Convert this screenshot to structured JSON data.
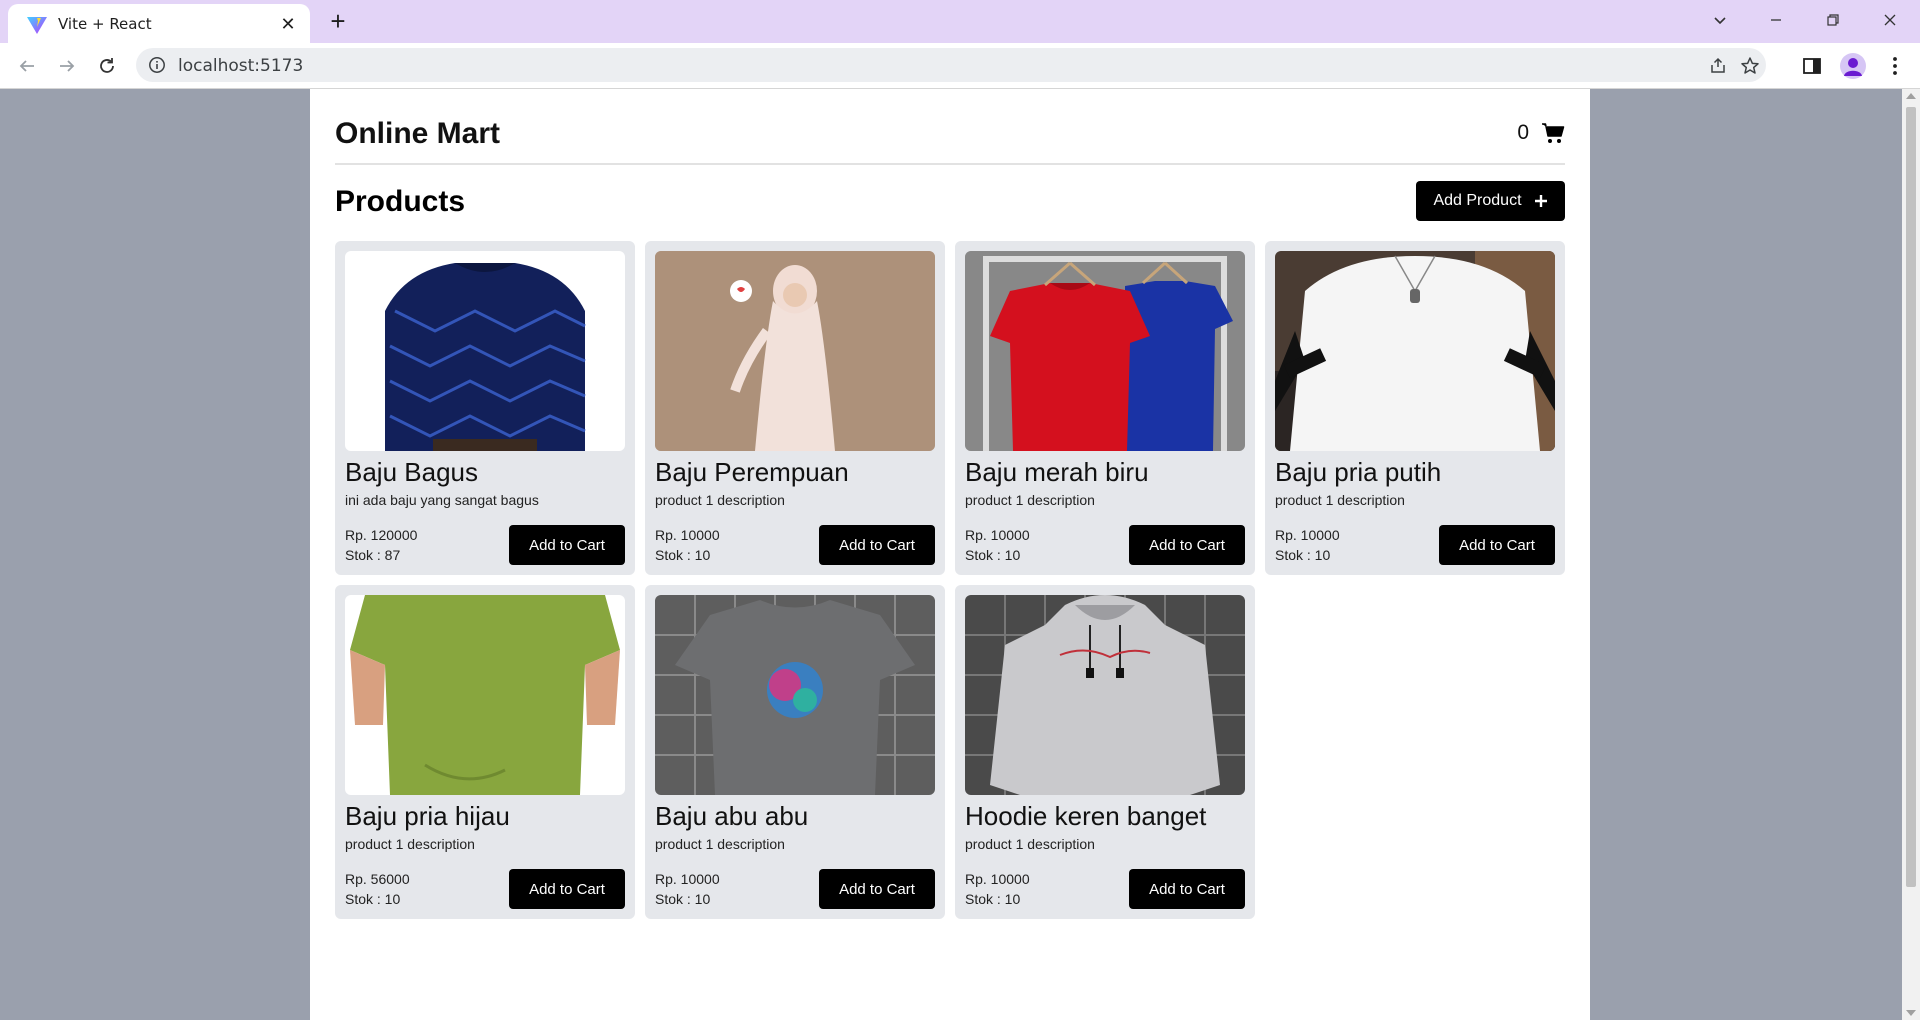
{
  "browser": {
    "tab_title": "Vite + React",
    "tab_close": "✕",
    "new_tab": "+",
    "url": "localhost:5173",
    "accent": "#e3d4f7"
  },
  "app": {
    "brand": "Online Mart",
    "cart_count": "0",
    "section_title": "Products",
    "add_product_label": "Add Product"
  },
  "products": [
    {
      "name": "Baju Bagus",
      "description": "ini ada baju yang sangat bagus",
      "price": "Rp. 120000",
      "stock": "Stok : 87",
      "button": "Add to Cart",
      "image": "navy-long-sleeve-shirt"
    },
    {
      "name": "Baju Perempuan",
      "description": "product 1 description",
      "price": "Rp. 10000",
      "stock": "Stok : 10",
      "button": "Add to Cart",
      "image": "woman-in-hijab-dress"
    },
    {
      "name": "Baju merah biru",
      "description": "product 1 description",
      "price": "Rp. 10000",
      "stock": "Stok : 10",
      "button": "Add to Cart",
      "image": "red-and-blue-tshirts"
    },
    {
      "name": "Baju pria putih",
      "description": "product 1 description",
      "price": "Rp. 10000",
      "stock": "Stok : 10",
      "button": "Add to Cart",
      "image": "white-sweatshirt"
    },
    {
      "name": "Baju pria hijau",
      "description": "product 1 description",
      "price": "Rp. 56000",
      "stock": "Stok : 10",
      "button": "Add to Cart",
      "image": "green-tshirt"
    },
    {
      "name": "Baju abu abu",
      "description": "product 1 description",
      "price": "Rp. 10000",
      "stock": "Stok : 10",
      "button": "Add to Cart",
      "image": "grey-graphic-tshirt"
    },
    {
      "name": "Hoodie keren banget",
      "description": "product 1 description",
      "price": "Rp. 10000",
      "stock": "Stok : 10",
      "button": "Add to Cart",
      "image": "grey-hoodie"
    }
  ]
}
